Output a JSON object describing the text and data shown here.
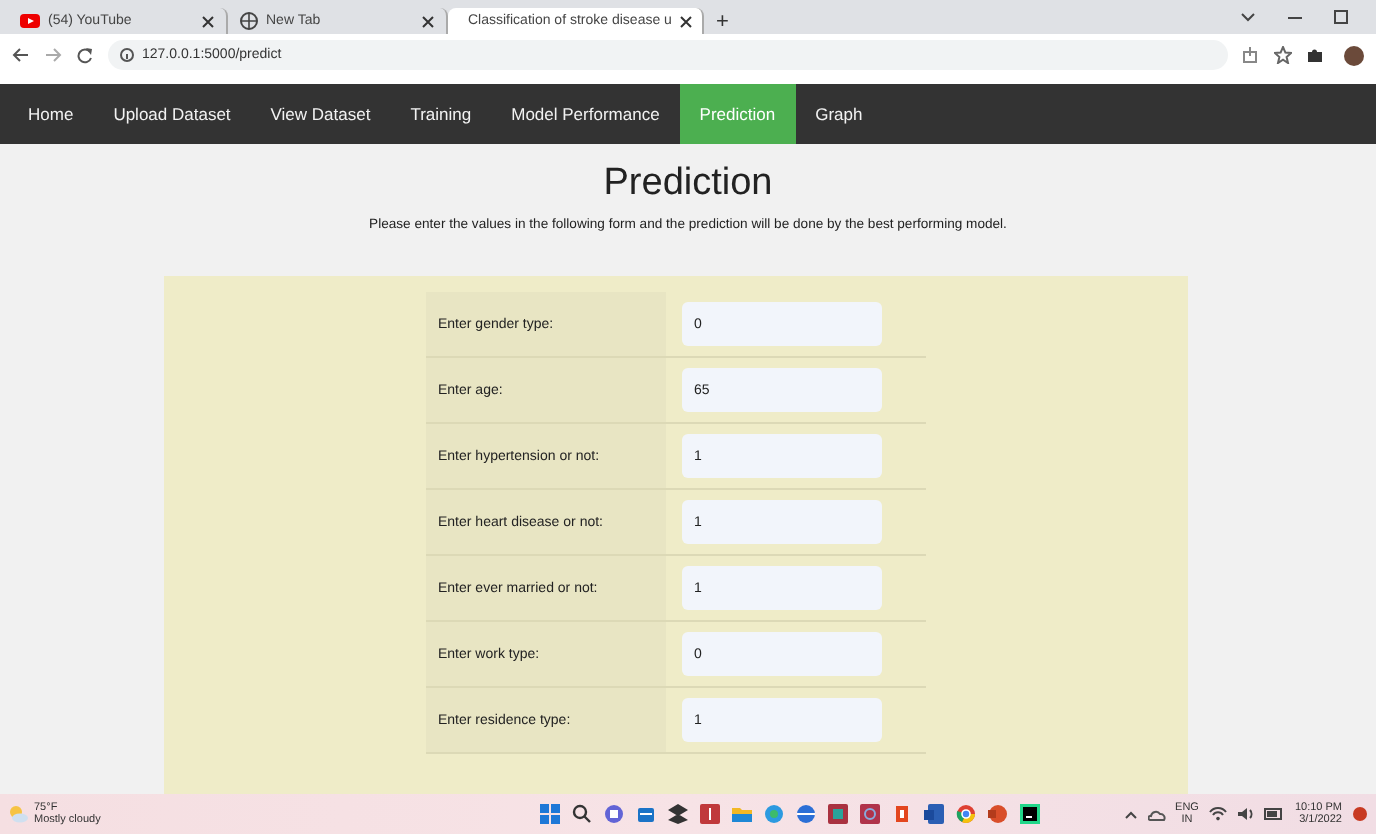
{
  "browser": {
    "tabs": [
      {
        "title": "(54) YouTube",
        "selected": false
      },
      {
        "title": "New Tab",
        "selected": false
      },
      {
        "title": "Classification of stroke disease u",
        "selected": true
      }
    ],
    "new_tab": "+",
    "address": "127.0.0.1:5000/predict"
  },
  "nav": [
    {
      "label": "Home",
      "selected": false
    },
    {
      "label": "Upload Dataset",
      "selected": false
    },
    {
      "label": "View Dataset",
      "selected": false
    },
    {
      "label": "Training",
      "selected": false
    },
    {
      "label": "Model Performance",
      "selected": false
    },
    {
      "label": "Prediction",
      "selected": true
    },
    {
      "label": "Graph",
      "selected": false
    }
  ],
  "page": {
    "title": "Prediction",
    "subtitle": "Please enter the values in the following form and the prediction will be done by the best performing model."
  },
  "form": [
    {
      "label": "Enter gender type:",
      "value": "0"
    },
    {
      "label": "Enter age:",
      "value": "65"
    },
    {
      "label": "Enter hypertension or not:",
      "value": "1"
    },
    {
      "label": "Enter heart disease or not:",
      "value": "1"
    },
    {
      "label": "Enter ever married or not:",
      "value": "1"
    },
    {
      "label": "Enter work type:",
      "value": "0"
    },
    {
      "label": "Enter residence type:",
      "value": "1"
    }
  ],
  "taskbar": {
    "temperature": "75°F",
    "weather": "Mostly cloudy",
    "language": "ENG",
    "region": "IN",
    "time": "10:10 PM",
    "date": "3/1/2022"
  }
}
